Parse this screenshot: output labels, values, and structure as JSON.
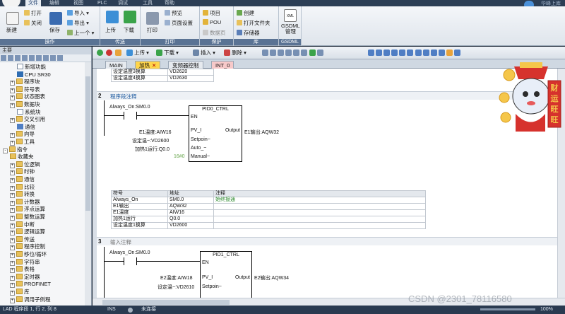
{
  "menubar": {
    "items": [
      "文件",
      "编辑",
      "视图",
      "PLC",
      "调试",
      "工具",
      "帮助"
    ],
    "active_index": 0,
    "brand": "华峰上库"
  },
  "ribbon": {
    "groups": [
      {
        "label": "操作",
        "items": [
          "新建",
          "打开",
          "关闭",
          "保存",
          "导入",
          "导出",
          "上一个"
        ]
      },
      {
        "label": "传送",
        "items": [
          "上传",
          "下载"
        ]
      },
      {
        "label": "打印",
        "items": [
          "打印",
          "预览",
          "页面设置"
        ]
      },
      {
        "label": "保护",
        "items": [
          "项目",
          "POU",
          "数据页"
        ]
      },
      {
        "label": "库",
        "items": [
          "创建",
          "打开文件夹",
          "存储器"
        ]
      },
      {
        "label": "GSDML",
        "items": [
          "GSDML\n管理"
        ]
      }
    ]
  },
  "leftpanel": {
    "title": "主要",
    "tree": [
      {
        "label": "新增功能",
        "indent": 2,
        "icon": "doc",
        "toggle": ""
      },
      {
        "label": "CPU SR30",
        "indent": 2,
        "icon": "cpu",
        "toggle": ""
      },
      {
        "label": "程序块",
        "indent": 1,
        "icon": "folder",
        "toggle": "+"
      },
      {
        "label": "符号表",
        "indent": 1,
        "icon": "folder",
        "toggle": "+"
      },
      {
        "label": "状态图表",
        "indent": 1,
        "icon": "folder",
        "toggle": "+"
      },
      {
        "label": "数据块",
        "indent": 1,
        "icon": "folder",
        "toggle": "+"
      },
      {
        "label": "系统块",
        "indent": 2,
        "icon": "doc",
        "toggle": ""
      },
      {
        "label": "交叉引用",
        "indent": 1,
        "icon": "folder",
        "toggle": "+"
      },
      {
        "label": "通信",
        "indent": 2,
        "icon": "blue",
        "toggle": ""
      },
      {
        "label": "向导",
        "indent": 1,
        "icon": "folder",
        "toggle": "+"
      },
      {
        "label": "工具",
        "indent": 1,
        "icon": "folder",
        "toggle": "+"
      },
      {
        "label": "指令",
        "indent": 0,
        "icon": "folder",
        "toggle": "-"
      },
      {
        "label": "收藏夹",
        "indent": 1,
        "icon": "folder",
        "toggle": ""
      },
      {
        "label": "位逻辑",
        "indent": 1,
        "icon": "folder",
        "toggle": "+"
      },
      {
        "label": "时钟",
        "indent": 1,
        "icon": "folder",
        "toggle": "+"
      },
      {
        "label": "通信",
        "indent": 1,
        "icon": "folder",
        "toggle": "+"
      },
      {
        "label": "比较",
        "indent": 1,
        "icon": "folder",
        "toggle": "+"
      },
      {
        "label": "转换",
        "indent": 1,
        "icon": "folder",
        "toggle": "+"
      },
      {
        "label": "计数器",
        "indent": 1,
        "icon": "folder",
        "toggle": "+"
      },
      {
        "label": "浮点运算",
        "indent": 1,
        "icon": "folder",
        "toggle": "+"
      },
      {
        "label": "整数运算",
        "indent": 1,
        "icon": "folder",
        "toggle": "+"
      },
      {
        "label": "中断",
        "indent": 1,
        "icon": "folder",
        "toggle": "+"
      },
      {
        "label": "逻辑运算",
        "indent": 1,
        "icon": "folder",
        "toggle": "+"
      },
      {
        "label": "传送",
        "indent": 1,
        "icon": "folder",
        "toggle": "+"
      },
      {
        "label": "程序控制",
        "indent": 1,
        "icon": "folder",
        "toggle": "+"
      },
      {
        "label": "移位/循环",
        "indent": 1,
        "icon": "folder",
        "toggle": "+"
      },
      {
        "label": "字符串",
        "indent": 1,
        "icon": "folder",
        "toggle": "+"
      },
      {
        "label": "表格",
        "indent": 1,
        "icon": "folder",
        "toggle": "+"
      },
      {
        "label": "定时器",
        "indent": 1,
        "icon": "folder",
        "toggle": "+"
      },
      {
        "label": "PROFINET",
        "indent": 1,
        "icon": "folder",
        "toggle": "+"
      },
      {
        "label": "库",
        "indent": 1,
        "icon": "folder",
        "toggle": "+"
      },
      {
        "label": "调用子例程",
        "indent": 1,
        "icon": "folder",
        "toggle": "+"
      }
    ]
  },
  "editor": {
    "toolbar": {
      "upload": "上传",
      "download": "下载",
      "insert": "插入",
      "delete": "删除"
    },
    "tabs": [
      {
        "label": "MAIN",
        "style": "normal"
      },
      {
        "label": "加热",
        "style": "active"
      },
      {
        "label": "变频器控制",
        "style": "normal"
      },
      {
        "label": "INT_0",
        "style": "pink"
      }
    ],
    "top_rows": [
      [
        "设定温度3换算",
        "VD2620"
      ],
      [
        "设定温度4换算",
        "VD2630"
      ]
    ],
    "network2": {
      "num": "2",
      "comment": "程序段注释",
      "contact": "Always_On:SM0.0",
      "block": "PID0_CTRL",
      "pins_left": [
        "EN",
        "PV_I",
        "Setpoin~",
        "Auto_~",
        "Manual~"
      ],
      "pin_right": "Output",
      "inputs": [
        "E1温度:AIW16",
        "设定温~:VD2600",
        "加热1运行:Q0.0",
        "16#0"
      ],
      "output": "E1输出:AQW32"
    },
    "symtable": {
      "headers": [
        "符号",
        "地址",
        "注释"
      ],
      "rows": [
        [
          "Always_On",
          "SM0.0",
          "始终接通"
        ],
        [
          "E1输出",
          "AQW32",
          ""
        ],
        [
          "E1温度",
          "AIW16",
          ""
        ],
        [
          "加热1运行",
          "Q0.0",
          ""
        ],
        [
          "设定温度1换算",
          "VD2600",
          ""
        ]
      ]
    },
    "network3": {
      "num": "3",
      "comment": "输入注释",
      "contact": "Always_On:SM0.0",
      "block": "PID1_CTRL",
      "pins_left": [
        "EN",
        "PV_I",
        "Setpoin~"
      ],
      "pin_right": "Output",
      "inputs": [
        "E2温度:AIW18",
        "设定温~:VD2610"
      ],
      "output": "E2输出:AQW34"
    }
  },
  "mascot": {
    "sign": "财运旺旺"
  },
  "status": {
    "position": "LAD 程序段 1, 行 2, 列 8",
    "mode": "INS",
    "connection": "未连接",
    "zoom": "100%"
  },
  "watermark": "CSDN @2301_78116580",
  "colors": {
    "accent": "#ffd54a",
    "ribbon_label": "#5a7394",
    "status_bg": "#2a3a50"
  }
}
